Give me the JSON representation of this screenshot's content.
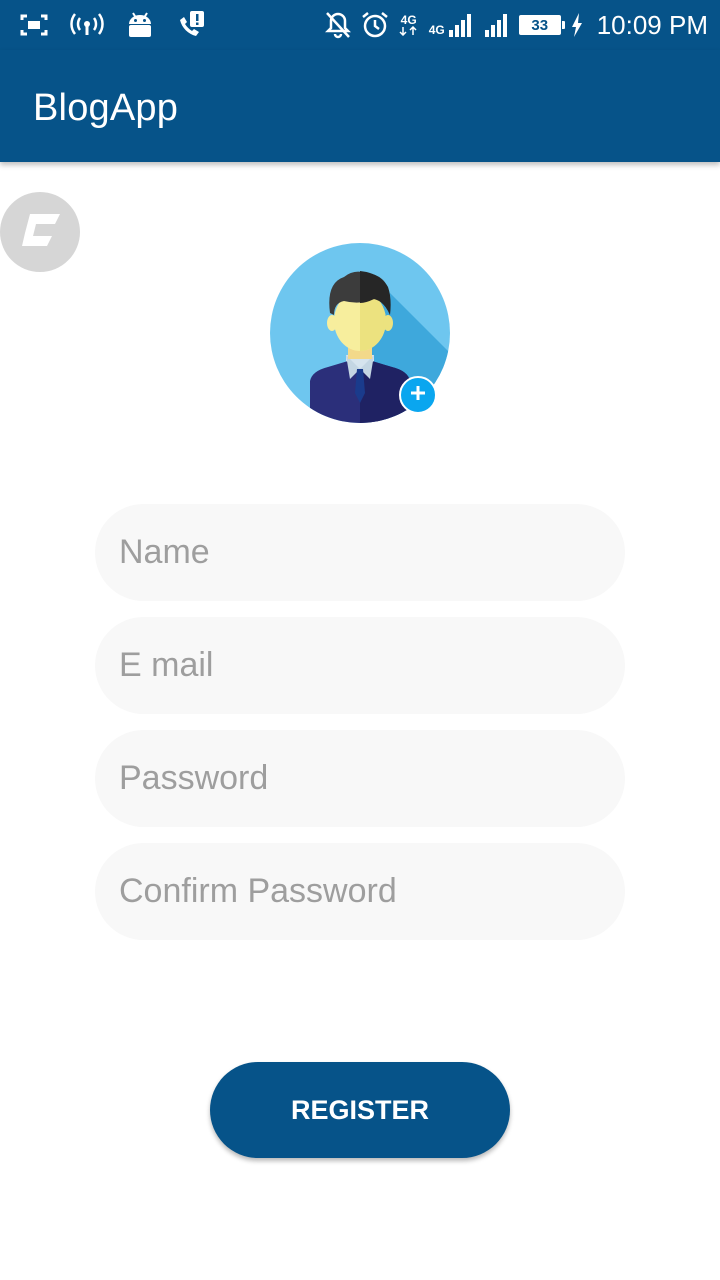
{
  "status_bar": {
    "network_label_1": "4G",
    "network_label_2": "4G",
    "battery_level": "33",
    "time": "10:09 PM",
    "icons": [
      "screenshot-icon",
      "hotspot-icon",
      "android-icon",
      "call-alert-icon",
      "mute-notifications-icon",
      "alarm-icon",
      "signal-icon",
      "signal-icon",
      "battery-icon",
      "charging-icon"
    ]
  },
  "app_bar": {
    "title": "BlogApp"
  },
  "overlay": {
    "icon": "c-logo-icon"
  },
  "avatar": {
    "icon": "user-avatar-icon",
    "add_icon": "plus-icon",
    "colors": {
      "circle": "#6ec6ef",
      "badge": "#0aa6ef"
    }
  },
  "form": {
    "name_placeholder": "Name",
    "email_placeholder": "E mail",
    "password_placeholder": "Password",
    "confirm_password_placeholder": "Confirm Password",
    "register_label": "REGISTER"
  },
  "colors": {
    "primary": "#065389",
    "field_background": "#f8f8f8",
    "placeholder": "#9e9e9e"
  }
}
